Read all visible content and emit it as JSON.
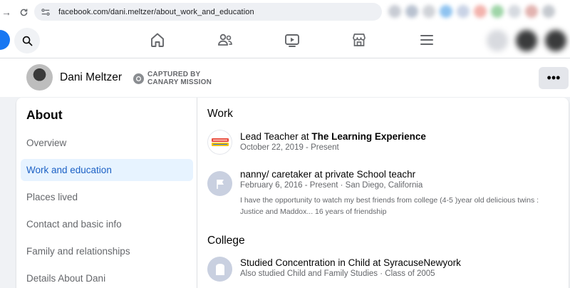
{
  "browser": {
    "url": "facebook.com/dani.meltzer/about_work_and_education"
  },
  "profile": {
    "name": "Dani Meltzer",
    "captured_line1": "CAPTURED BY",
    "captured_line2": "CANARY MISSION",
    "more_label": "•••"
  },
  "about": {
    "title": "About",
    "menu": [
      {
        "label": "Overview"
      },
      {
        "label": "Work and education"
      },
      {
        "label": "Places lived"
      },
      {
        "label": "Contact and basic info"
      },
      {
        "label": "Family and relationships"
      },
      {
        "label": "Details About Dani"
      }
    ],
    "active_index": 1
  },
  "work": {
    "title": "Work",
    "entries": [
      {
        "role_prefix": "Lead Teacher at ",
        "org": "The Learning Experience",
        "dates": "October 22, 2019 - Present",
        "logo": "learning-experience-logo"
      },
      {
        "role": "nanny/ caretaker at private School teachr",
        "dates": "February 6, 2016 - Present · San Diego, California",
        "description": "I have the opportunity to watch my best friends from college (4-5 )year old delicious twins : Justice and Maddox... 16 years of friendship",
        "logo": "flag-placeholder-icon"
      }
    ]
  },
  "college": {
    "title": "College",
    "entries": [
      {
        "line": "Studied Concentration in Child at SyracuseNewyork",
        "sub": "Also studied Child and Family Studies · Class of 2005",
        "logo": "school-placeholder-icon"
      }
    ]
  },
  "colors": {
    "fb_blue": "#1877f2",
    "active_bg": "#e7f3ff",
    "active_text": "#1b60c5",
    "secondary_text": "#65676b"
  }
}
